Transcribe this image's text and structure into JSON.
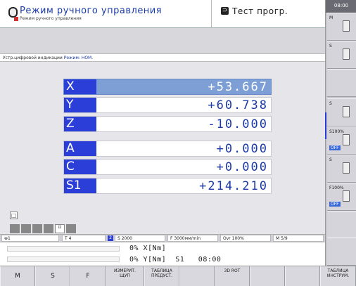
{
  "header": {
    "mode_title": "Режим ручного управления",
    "mode_subtitle": "Режим ручного управления",
    "run_mode_title": "Тест прогр."
  },
  "status_line": {
    "label": "Устр.цифровой индикации",
    "mode": "Режим: НОМ."
  },
  "axes": [
    {
      "label": "X",
      "value": "+53.667",
      "highlighted": true
    },
    {
      "label": "Y",
      "value": "+60.738",
      "highlighted": false
    },
    {
      "label": "Z",
      "value": "-10.000",
      "highlighted": false
    },
    {
      "label": "A",
      "value": "+0.000",
      "highlighted": false
    },
    {
      "label": "C",
      "value": "+0.000",
      "highlighted": false
    },
    {
      "label": "S1",
      "value": "+214.210",
      "highlighted": false
    }
  ],
  "info_bar": {
    "point": "1",
    "tool": "T 4",
    "spindle_badge": "2",
    "spindle": "S 2000",
    "feed": "F 3000мм/min",
    "override": "Ovr 100%",
    "mfunc": "M 5/9"
  },
  "feed_area": {
    "line1": "0% X[Nm]",
    "line2": "0% Y[Nm]  S1   08:00"
  },
  "softkeys": [
    {
      "label": "M",
      "big": true
    },
    {
      "label": "S",
      "big": true
    },
    {
      "label": "F",
      "big": true
    },
    {
      "label": "ИЗМЕРИТ.\nЩУП",
      "big": false
    },
    {
      "label": "ТАБЛИЦА\nПРЕДУСТ.",
      "big": false
    },
    {
      "label": "",
      "big": false
    },
    {
      "label": "3D ROT",
      "big": false
    },
    {
      "label": "",
      "big": false
    },
    {
      "label": "",
      "big": false
    },
    {
      "label": "ТАБЛИЦА\nИНСТРУМ.",
      "big": false
    }
  ],
  "side": {
    "clock": "08:00",
    "keys": [
      {
        "tag": "M"
      },
      {
        "tag": "S"
      },
      {
        "tag": ""
      },
      {
        "tag": "S"
      },
      {
        "tag": "S100%",
        "off": "OFF"
      },
      {
        "tag": "S"
      },
      {
        "tag": "F100%",
        "off": "OFF"
      },
      {
        "tag": ""
      },
      {
        "tag": ""
      }
    ]
  },
  "colors": {
    "axis_label_bg": "#2b3fd8",
    "highlight_row": "#7d9fd6",
    "value_text": "#1a3aa8"
  }
}
